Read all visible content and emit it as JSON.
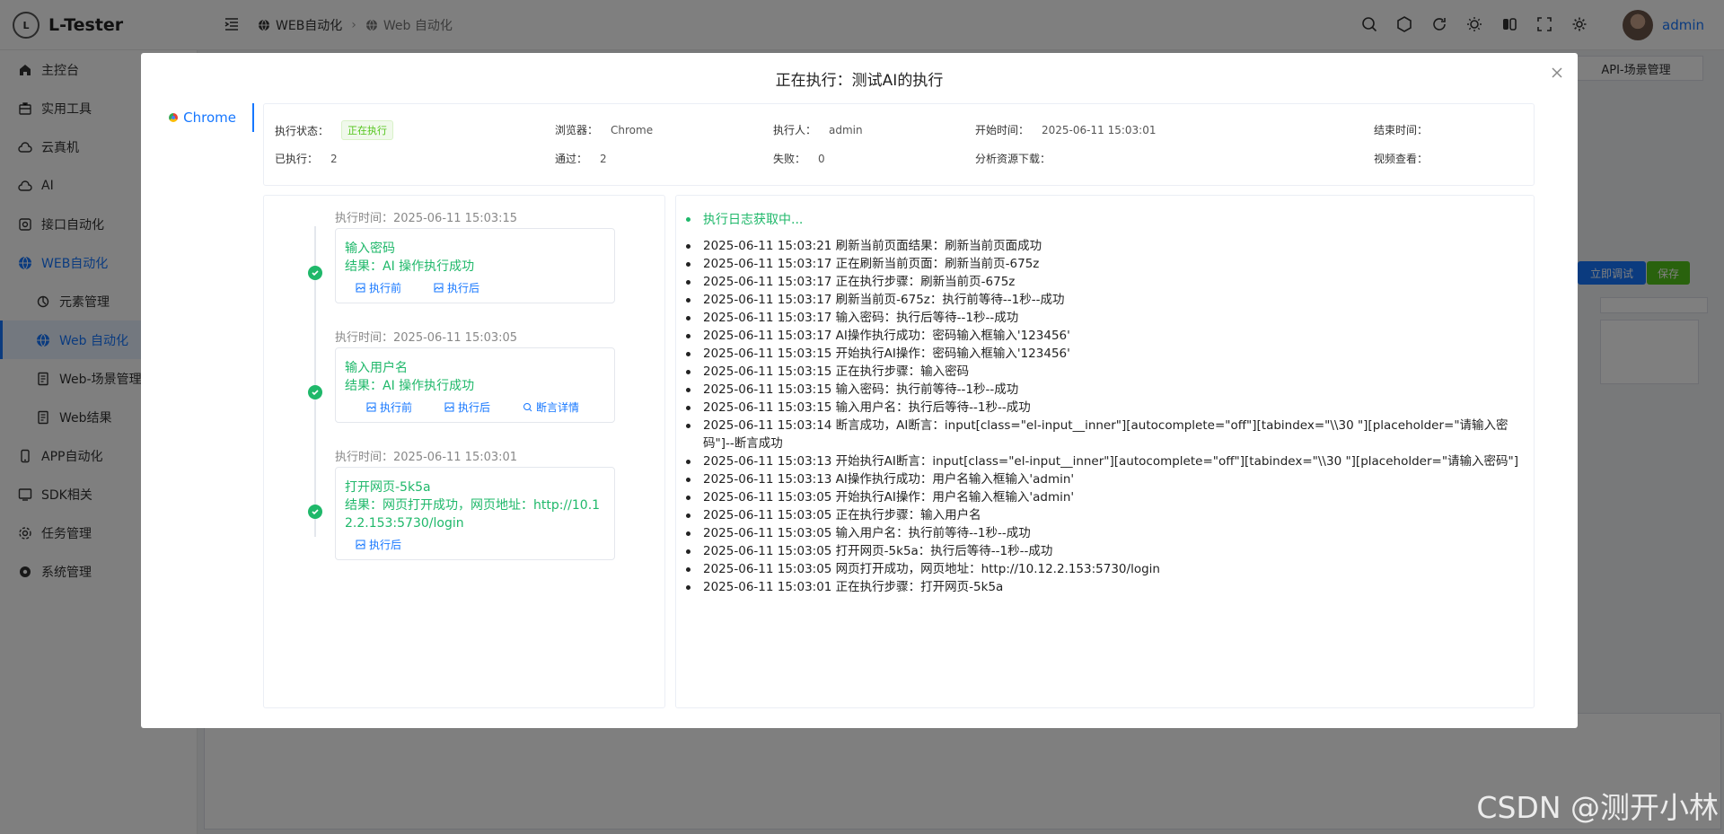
{
  "app": {
    "name": "L-Tester",
    "user": "admin"
  },
  "breadcrumb": [
    "WEB自动化",
    "Web 自动化"
  ],
  "sidebar": {
    "items": [
      {
        "label": "主控台",
        "icon": "home-icon"
      },
      {
        "label": "实用工具",
        "icon": "toolbox-icon"
      },
      {
        "label": "云真机",
        "icon": "cloud-icon"
      },
      {
        "label": "AI",
        "icon": "cloud-ai-icon"
      },
      {
        "label": "接口自动化",
        "icon": "api-icon"
      },
      {
        "label": "WEB自动化",
        "icon": "globe-icon"
      },
      {
        "label": "元素管理",
        "icon": "element-icon"
      },
      {
        "label": "Web 自动化",
        "icon": "globe-icon"
      },
      {
        "label": "Web-场景管理",
        "icon": "document-icon"
      },
      {
        "label": "Web结果",
        "icon": "document-icon"
      },
      {
        "label": "APP自动化",
        "icon": "phone-icon"
      },
      {
        "label": "SDK相关",
        "icon": "sdk-icon"
      },
      {
        "label": "任务管理",
        "icon": "gear-icon"
      },
      {
        "label": "系统管理",
        "icon": "settings-icon"
      }
    ]
  },
  "background": {
    "scene_btn": "API-场景管理",
    "debug_btn": "立即调试",
    "save_btn": "保存"
  },
  "dialog": {
    "title": "正在执行：测试AI的执行",
    "browser_tab": "Chrome",
    "info": {
      "status_label": "执行状态：",
      "status_value": "正在执行",
      "browser_label": "浏览器：",
      "browser_value": "Chrome",
      "executor_label": "执行人：",
      "executor_value": "admin",
      "start_label": "开始时间：",
      "start_value": "2025-06-11 15:03:01",
      "end_label": "结束时间：",
      "end_value": "",
      "executed_label": "已执行：",
      "executed_value": "2",
      "passed_label": "通过：",
      "passed_value": "2",
      "failed_label": "失败：",
      "failed_value": "0",
      "resource_label": "分析资源下载：",
      "video_label": "视频查看："
    },
    "timeline": [
      {
        "time": "执行时间：2025-06-11 15:03:15",
        "step": "输入密码",
        "result": "结果：AI 操作执行成功",
        "links": [
          "执行前",
          "执行后"
        ]
      },
      {
        "time": "执行时间：2025-06-11 15:03:05",
        "step": "输入用户名",
        "result": "结果：AI 操作执行成功",
        "links": [
          "执行前",
          "执行后",
          "断言详情"
        ]
      },
      {
        "time": "执行时间：2025-06-11 15:03:01",
        "step": "打开网页-5k5a",
        "result": "结果：网页打开成功，网页地址：http://10.12.2.153:5730/login",
        "links": [
          "执行后"
        ]
      }
    ],
    "log_header": "执行日志获取中...",
    "logs": [
      "2025-06-11 15:03:21 刷新当前页面结果：刷新当前页面成功",
      "2025-06-11 15:03:17 正在刷新当前页面：刷新当前页-675z",
      "2025-06-11 15:03:17 正在执行步骤：刷新当前页-675z",
      "2025-06-11 15:03:17 刷新当前页-675z：执行前等待--1秒--成功",
      "2025-06-11 15:03:17 输入密码：执行后等待--1秒--成功",
      "2025-06-11 15:03:17 AI操作执行成功：密码输入框输入'123456'",
      "2025-06-11 15:03:15 开始执行AI操作：密码输入框输入'123456'",
      "2025-06-11 15:03:15 正在执行步骤：输入密码",
      "2025-06-11 15:03:15 输入密码：执行前等待--1秒--成功",
      "2025-06-11 15:03:15 输入用户名：执行后等待--1秒--成功",
      "2025-06-11 15:03:14 断言成功，AI断言：input[class=\"el-input__inner\"][autocomplete=\"off\"][tabindex=\"\\\\30 \"][placeholder=\"请输入密码\"]--断言成功",
      "2025-06-11 15:03:13 开始执行AI断言：input[class=\"el-input__inner\"][autocomplete=\"off\"][tabindex=\"\\\\30 \"][placeholder=\"请输入密码\"]",
      "2025-06-11 15:03:13 AI操作执行成功：用户名输入框输入'admin'",
      "2025-06-11 15:03:05 开始执行AI操作：用户名输入框输入'admin'",
      "2025-06-11 15:03:05 正在执行步骤：输入用户名",
      "2025-06-11 15:03:05 输入用户名：执行前等待--1秒--成功",
      "2025-06-11 15:03:05 打开网页-5k5a：执行后等待--1秒--成功",
      "2025-06-11 15:03:05 网页打开成功，网页地址：http://10.12.2.153:5730/login",
      "2025-06-11 15:03:01 正在执行步骤：打开网页-5k5a"
    ]
  },
  "watermark": "CSDN @测开小林",
  "colors": {
    "accent": "#1677ff",
    "success": "#1fb86a"
  }
}
